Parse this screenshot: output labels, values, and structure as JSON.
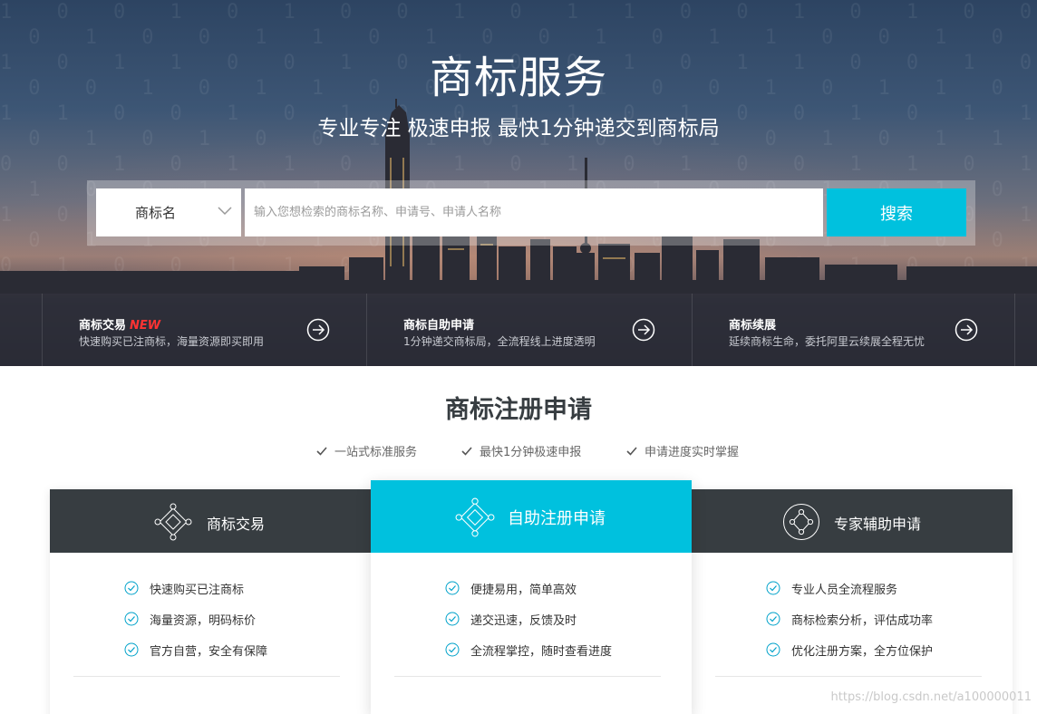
{
  "hero": {
    "title": "商标服务",
    "subtitle": "专业专注 极速申报 最快1分钟递交到商标局"
  },
  "search": {
    "type_label": "商标名",
    "placeholder": "输入您想检索的商标名称、申请号、申请人名称",
    "button_label": "搜索"
  },
  "services": [
    {
      "title": "商标交易",
      "badge": "NEW",
      "desc": "快速购买已注商标，海量资源即买即用"
    },
    {
      "title": "商标自助申请",
      "badge": "",
      "desc": "1分钟递交商标局，全流程线上进度透明"
    },
    {
      "title": "商标续展",
      "badge": "",
      "desc": "延续商标生命，委托阿里云续展全程无忧"
    }
  ],
  "section": {
    "title": "商标注册申请",
    "features": [
      "一站式标准服务",
      "最快1分钟极速申报",
      "申请进度实时掌握"
    ]
  },
  "cards": [
    {
      "title": "商标交易",
      "icon": "diamond-network-icon",
      "items": [
        "快速购买已注商标",
        "海量资源，明码标价",
        "官方自营，安全有保障"
      ]
    },
    {
      "title": "自助注册申请",
      "icon": "diamond-network-icon",
      "items": [
        "便捷易用，简单高效",
        "递交迅速，反馈及时",
        "全流程掌控，随时查看进度"
      ]
    },
    {
      "title": "专家辅助申请",
      "icon": "circle-network-icon",
      "items": [
        "专业人员全流程服务",
        "商标检索分析，评估成功率",
        "优化注册方案，全方位保护"
      ]
    }
  ],
  "watermark": "https://blog.csdn.net/a100000011",
  "colors": {
    "accent": "#00c1de",
    "dark_header": "#373d41",
    "badge_red": "#ff3333"
  }
}
